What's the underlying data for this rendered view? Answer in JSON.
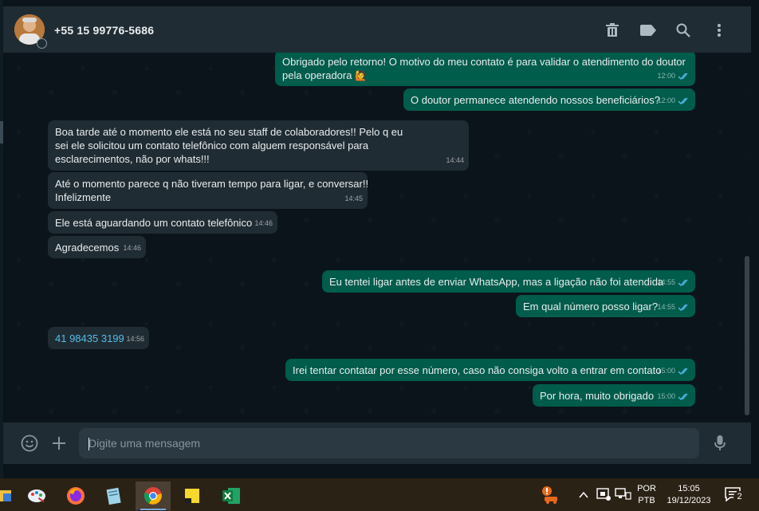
{
  "header": {
    "contact_name": "+55 15 99776-5686",
    "icons": [
      "delete-icon",
      "label-icon",
      "search-icon",
      "menu-icon"
    ]
  },
  "messages": [
    {
      "dir": "out",
      "text": "Obrigado pelo retorno! O motivo do meu contato é para validar o atendimento do doutor pela operadora",
      "emoji": "🙋",
      "time": "12:00",
      "status": "read"
    },
    {
      "dir": "out",
      "text": "O doutor permanece atendendo nossos beneficiários?",
      "time": "12:00",
      "status": "read"
    },
    {
      "dir": "in",
      "text": "Boa tarde até o momento ele está no seu staff de colaboradores!! Pelo q eu sei ele solicitou um contato telefônico com alguem responsável para esclarecimentos, não por whats!!!",
      "time": "14:44"
    },
    {
      "dir": "in",
      "text": "Até o momento parece q não tiveram tempo para ligar, e conversar!! Infelizmente",
      "time": "14:45"
    },
    {
      "dir": "in",
      "text": "Ele está aguardando um contato telefônico",
      "time": "14:46"
    },
    {
      "dir": "in",
      "text": "Agradecemos",
      "time": "14:46"
    },
    {
      "dir": "out",
      "text": "Eu tentei ligar antes de enviar WhatsApp, mas a ligação não foi atendida",
      "time": "14:55",
      "status": "read"
    },
    {
      "dir": "out",
      "text": "Em qual número posso ligar?",
      "time": "14:55",
      "status": "read"
    },
    {
      "dir": "in",
      "text": "41 98435 3199",
      "time": "14:56",
      "link": true
    },
    {
      "dir": "out",
      "text": "Irei tentar contatar por esse número, caso não consiga volto a entrar em contato",
      "time": "15:00",
      "status": "read"
    },
    {
      "dir": "out",
      "text": "Por hora, muito obrigado",
      "time": "15:00",
      "status": "read"
    }
  ],
  "composer": {
    "placeholder": "Digite uma mensagem",
    "icons": [
      "emoji-icon",
      "attach-plus-icon",
      "microphone-icon"
    ]
  },
  "taskbar": {
    "apps": [
      "snipping-tool-icon",
      "paint-icon",
      "firefox-icon",
      "notepad-icon",
      "chrome-icon",
      "sticky-notes-icon",
      "excel-icon"
    ],
    "language_line1": "POR",
    "language_line2": "PTB",
    "time": "15:05",
    "date": "19/12/2023",
    "notification_count": "2"
  },
  "colors": {
    "bg": "#0b141a",
    "header": "#202c33",
    "bubble_in": "#202c33",
    "bubble_out": "#005c4b",
    "read_tick": "#53bdeb"
  }
}
